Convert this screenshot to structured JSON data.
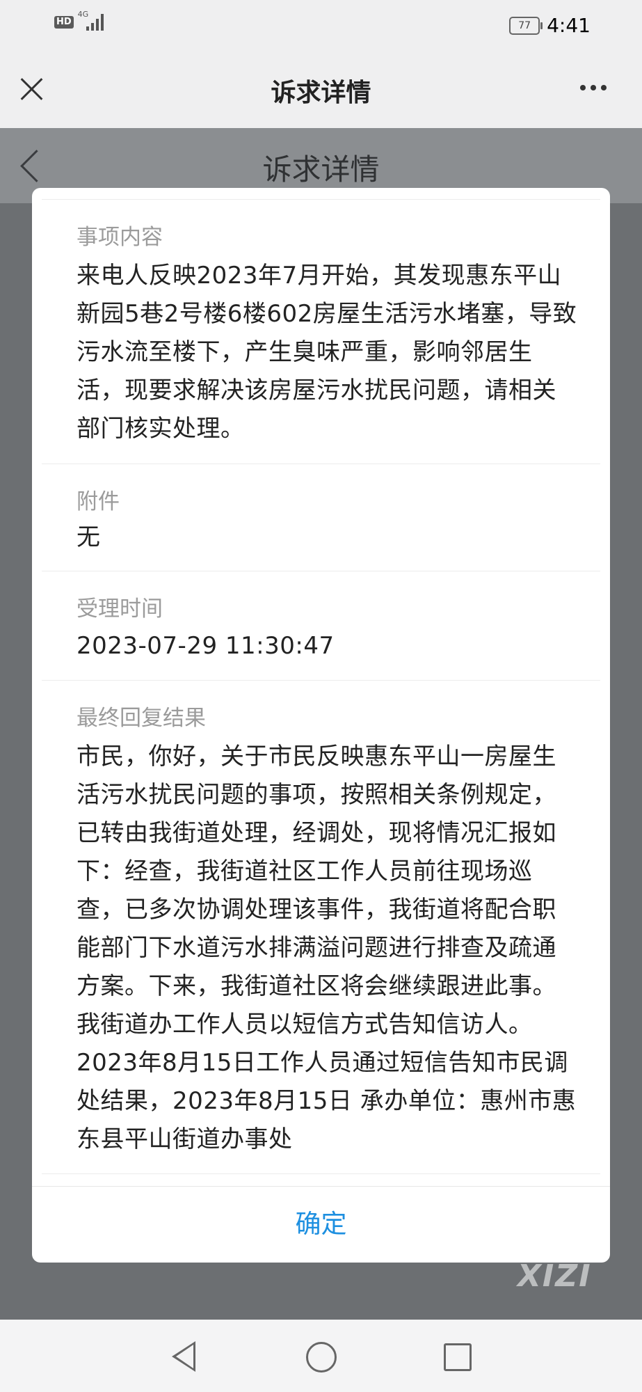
{
  "status_bar": {
    "hd": "HD",
    "network": "4G",
    "battery": "77",
    "time": "4:41"
  },
  "header": {
    "title": "诉求详情"
  },
  "background_page": {
    "title": "诉求详情"
  },
  "dialog": {
    "sections": [
      {
        "label": "事项内容",
        "value": "来电人反映2023年7月开始，其发现惠东平山新园5巷2号楼6楼602房屋生活污水堵塞，导致污水流至楼下，产生臭味严重，影响邻居生活，现要求解决该房屋污水扰民问题，请相关部门核实处理。"
      },
      {
        "label": "附件",
        "value": "无"
      },
      {
        "label": "受理时间",
        "value": "2023-07-29 11:30:47"
      },
      {
        "label": "最终回复结果",
        "value": "市民，你好，关于市民反映惠东平山一房屋生活污水扰民问题的事项，按照相关条例规定，已转由我街道处理，经调处，现将情况汇报如下：经查，我街道社区工作人员前往现场巡查，已多次协调处理该事件，我街道将配合职能部门下水道污水排满溢问题进行排查及疏通方案。下来，我街道社区将会继续跟进此事。我街道办工作人员以短信方式告知信访人。2023年8月15日工作人员通过短信告知市民调处结果，2023年8月15日 承办单位：惠州市惠东县平山街道办事处"
      }
    ],
    "confirm_label": "确定"
  },
  "watermark": "XIZI",
  "colors": {
    "accent": "#1d8fe0",
    "backdrop": "#6c6f72"
  }
}
